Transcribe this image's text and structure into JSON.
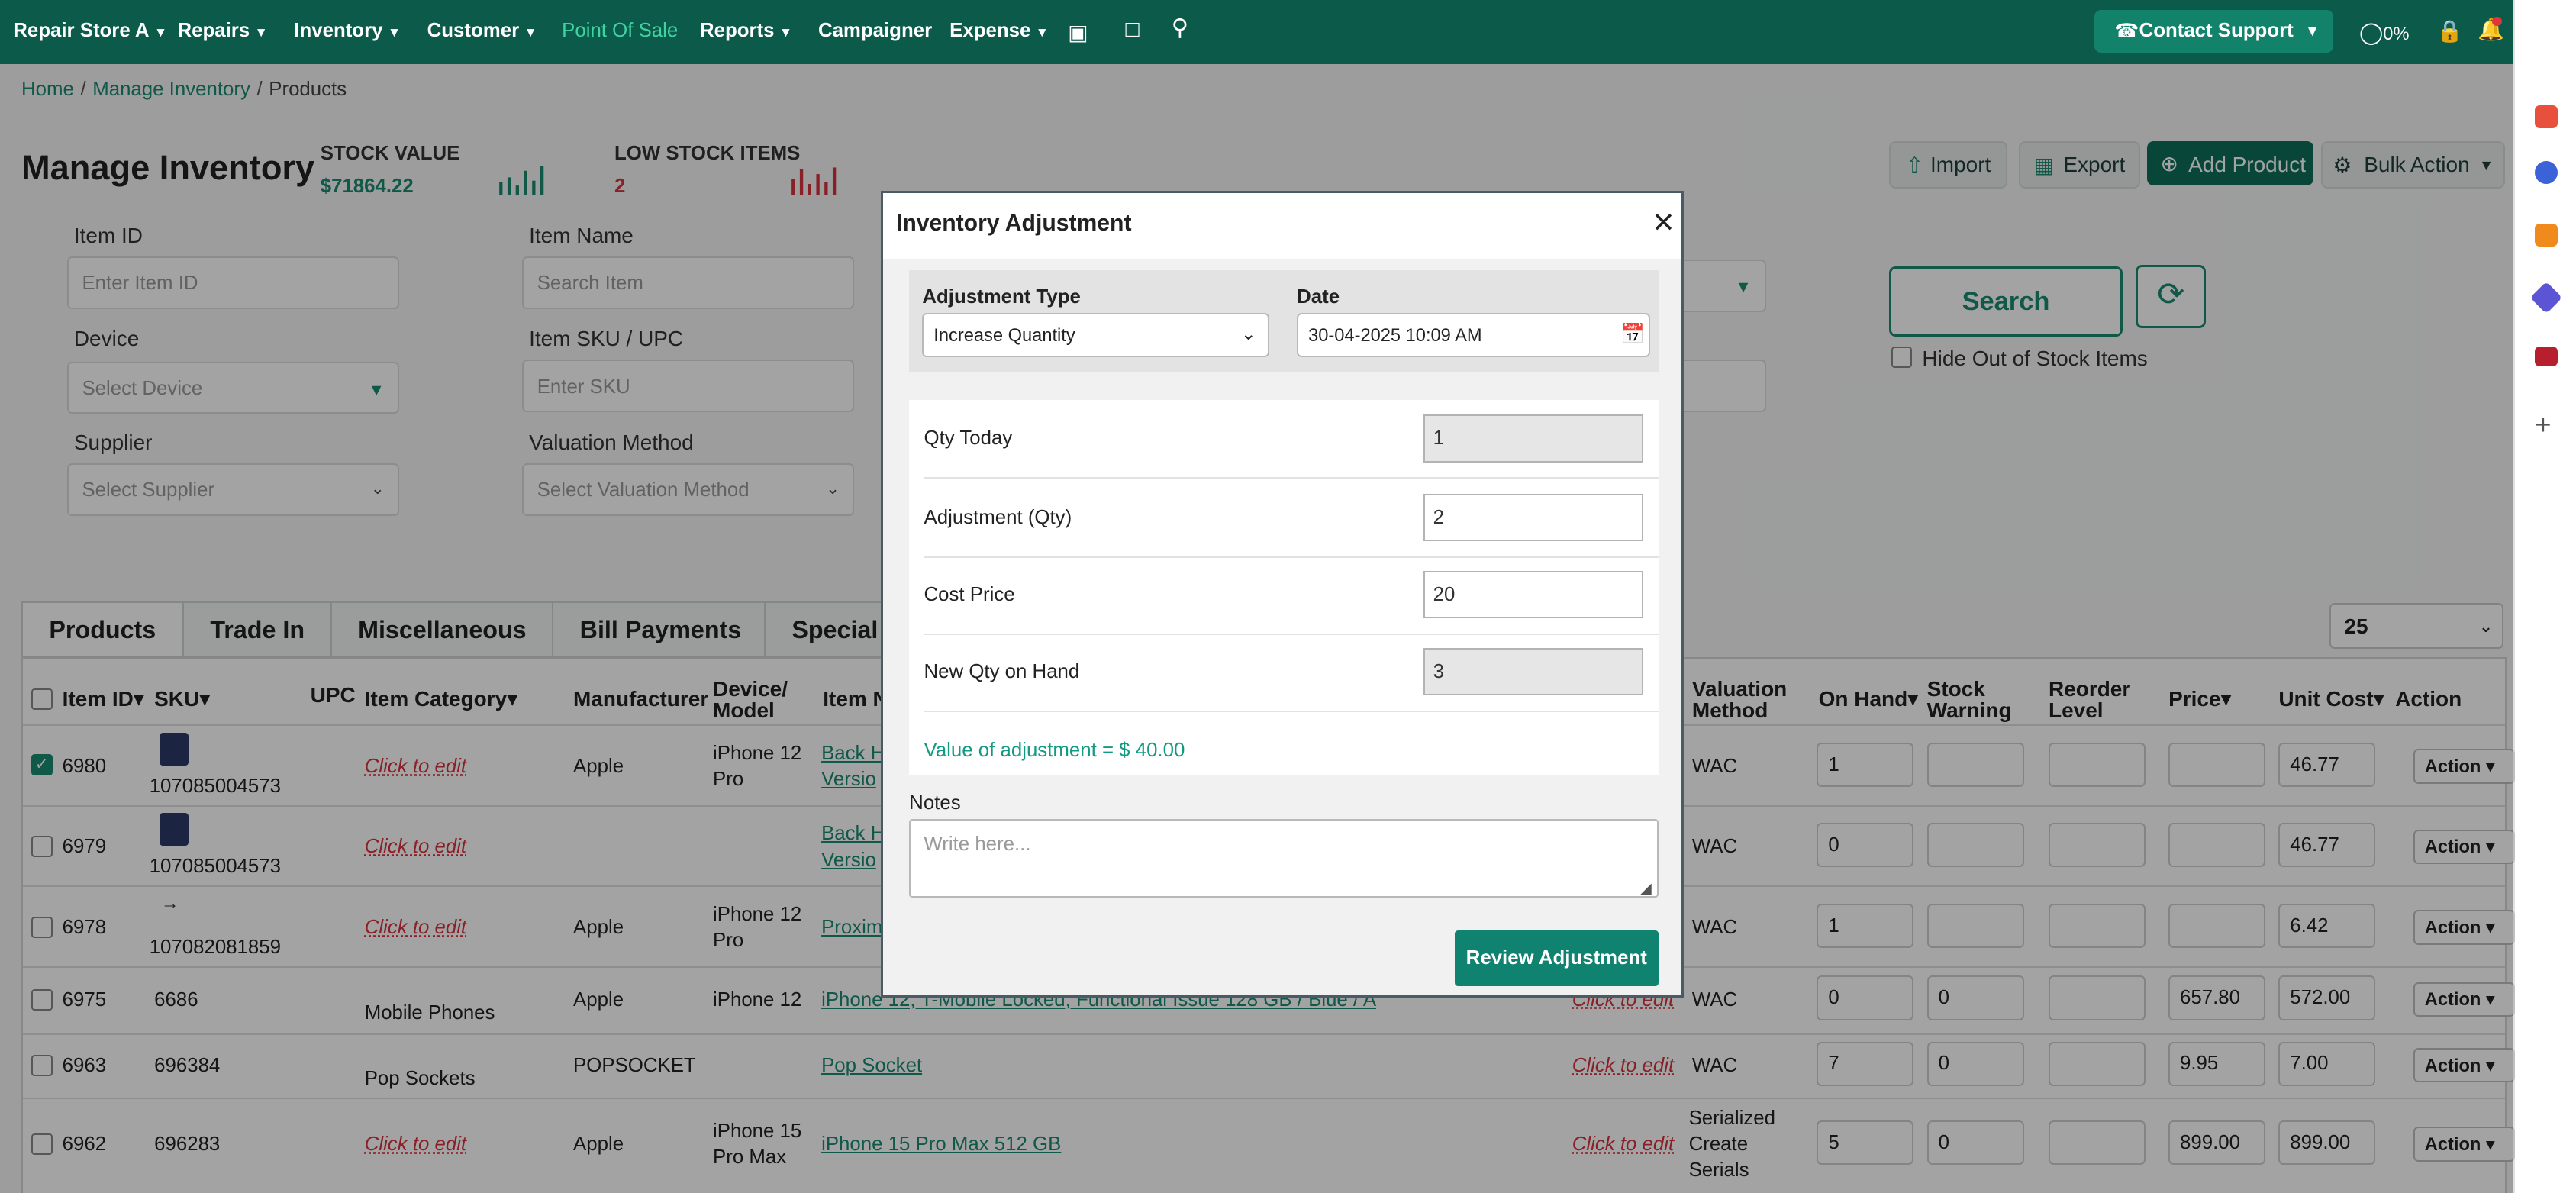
{
  "nav": {
    "store": "Repair Store A",
    "items": [
      "Repairs",
      "Inventory",
      "Customer",
      "Point Of Sale",
      "Reports",
      "Campaigner",
      "Expense"
    ],
    "support": "Contact Support",
    "progress": "0%"
  },
  "breadcrumb": {
    "home": "Home",
    "manage": "Manage Inventory",
    "current": "Products"
  },
  "header": {
    "title": "Manage Inventory",
    "stock_value_label": "STOCK VALUE",
    "stock_value": "$71864.22",
    "low_stock_label": "LOW STOCK ITEMS",
    "low_stock_value": "2",
    "import_label": "Import",
    "export_label": "Export",
    "add_label": "Add Product",
    "bulk_label": "Bulk Action"
  },
  "filters": {
    "item_id_label": "Item ID",
    "item_id_ph": "Enter Item ID",
    "item_name_label": "Item Name",
    "item_name_ph": "Search Item",
    "device_label": "Device",
    "device_ph": "Select Device",
    "sku_label": "Item SKU / UPC",
    "sku_ph": "Enter SKU",
    "supplier_label": "Supplier",
    "supplier_ph": "Select Supplier",
    "valuation_label": "Valuation Method",
    "valuation_ph": "Select Valuation Method",
    "search_label": "Search",
    "hide_label": "Hide Out of Stock Items"
  },
  "tabs": [
    "Products",
    "Trade In",
    "Miscellaneous",
    "Bill Payments",
    "Special"
  ],
  "page_size": "25",
  "table": {
    "headers": {
      "item_id": "Item ID",
      "sku": "SKU",
      "upc": "UPC",
      "category": "Item Category",
      "manufacturer": "Manufacturer",
      "device1": "Device/",
      "device2": "Model",
      "item_name": "Item N",
      "val1": "Valuation",
      "val2": "Method",
      "on_hand": "On Hand",
      "sw1": "Stock",
      "sw2": "Warning",
      "rl1": "Reorder",
      "rl2": "Level",
      "price": "Price",
      "unit_cost": "Unit Cost",
      "action": "Action"
    },
    "rows": [
      {
        "id": "6980",
        "sku": "107085004573",
        "category": "Click to edit",
        "manufacturer": "Apple",
        "device1": "iPhone 12",
        "device2": "Pro",
        "name1": "Back H",
        "name2": "Versio",
        "val1": "WAC",
        "val2": "",
        "val3": "",
        "on_hand": "1",
        "warning": "",
        "price": "",
        "cost": "46.77",
        "action": "Action"
      },
      {
        "id": "6979",
        "sku": "107085004573",
        "category": "Click to edit",
        "manufacturer": "",
        "device1": "",
        "device2": "",
        "name1": "Back H",
        "name2": "Versio",
        "val1": "WAC",
        "val2": "",
        "val3": "",
        "on_hand": "0",
        "warning": "",
        "price": "",
        "cost": "46.77",
        "action": "Action"
      },
      {
        "id": "6978",
        "sku": "107082081859",
        "category": "Click to edit",
        "manufacturer": "Apple",
        "device1": "iPhone 12",
        "device2": "Pro",
        "name1": "Proximi",
        "name2": "",
        "val1": "WAC",
        "val2": "",
        "val3": "",
        "on_hand": "1",
        "warning": "",
        "price": "",
        "cost": "6.42",
        "action": "Action"
      },
      {
        "id": "6975",
        "sku": "6686",
        "category": "Mobile Phones",
        "manufacturer": "Apple",
        "device1": "iPhone 12",
        "device2": "",
        "name1": "iPhone 12, T-Mobile Locked, Functional Issue 128 GB / Blue / A",
        "name2": "",
        "val1": "WAC",
        "val2": "",
        "val3": "",
        "on_hand": "0",
        "warning": "0",
        "price": "657.80",
        "cost": "572.00",
        "action": "Action"
      },
      {
        "id": "6963",
        "sku": "696384",
        "category": "Pop Sockets",
        "manufacturer": "POPSOCKET",
        "device1": "",
        "device2": "",
        "name1": "Pop Socket",
        "name2": "",
        "val1": "WAC",
        "val2": "",
        "val3": "",
        "on_hand": "7",
        "warning": "0",
        "price": "9.95",
        "cost": "7.00",
        "action": "Action"
      },
      {
        "id": "6962",
        "sku": "696283",
        "category": "Click to edit",
        "manufacturer": "Apple",
        "device1": "iPhone 15",
        "device2": "Pro Max",
        "name1": "iPhone 15 Pro Max 512 GB",
        "name2": "",
        "val1": "Serialized",
        "val2": "Create",
        "val3": "Serials",
        "on_hand": "5",
        "warning": "0",
        "price": "899.00",
        "cost": "899.00",
        "action": "Action"
      }
    ],
    "click_to_edit": "Click to edit"
  },
  "modal": {
    "title": "Inventory Adjustment",
    "adjustment_type_label": "Adjustment Type",
    "adjustment_type": "Increase Quantity",
    "date_label": "Date",
    "date": "30-04-2025 10:09 AM",
    "qty_today_label": "Qty Today",
    "qty_today": "1",
    "adjustment_qty_label": "Adjustment (Qty)",
    "adjustment_qty": "2",
    "cost_price_label": "Cost Price",
    "cost_price": "20",
    "new_qty_label": "New Qty on Hand",
    "new_qty": "3",
    "value_text": "Value of adjustment = $ 40.00",
    "notes_label": "Notes",
    "notes_placeholder": "Write here...",
    "review_label": "Review Adjustment"
  },
  "colors": {
    "nav": "#0c5a4a",
    "accent": "#0f8270",
    "danger": "#d8333e"
  }
}
